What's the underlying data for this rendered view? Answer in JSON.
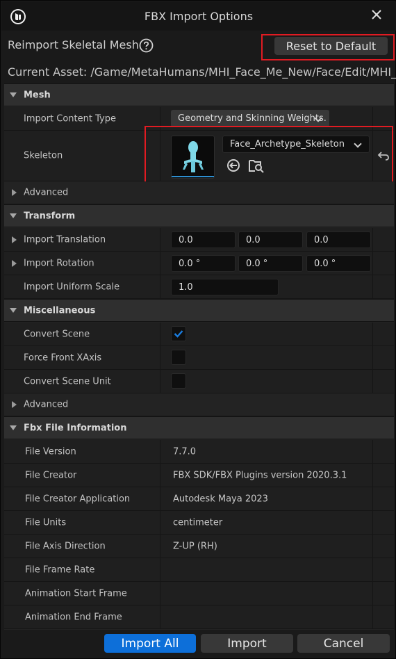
{
  "window": {
    "title": "FBX Import Options"
  },
  "header": {
    "reimport_label": "Reimport Skeletal Mesh",
    "reset_label": "Reset to Default",
    "current_asset": "Current Asset:  /Game/MetaHumans/MHI_Face_Me_New/Face/Edit/MHI_"
  },
  "mesh": {
    "category": "Mesh",
    "import_content_type": {
      "label": "Import Content Type",
      "value": "Geometry and Skinning Weights."
    },
    "skeleton": {
      "label": "Skeleton",
      "value": "Face_Archetype_Skeleton"
    },
    "advanced": "Advanced"
  },
  "transform": {
    "category": "Transform",
    "translation": {
      "label": "Import Translation",
      "x": "0.0",
      "y": "0.0",
      "z": "0.0"
    },
    "rotation": {
      "label": "Import Rotation",
      "x": "0.0 °",
      "y": "0.0 °",
      "z": "0.0 °"
    },
    "scale": {
      "label": "Import Uniform Scale",
      "value": "1.0"
    }
  },
  "misc": {
    "category": "Miscellaneous",
    "convert_scene": {
      "label": "Convert Scene",
      "checked": true
    },
    "force_front_xaxis": {
      "label": "Force Front XAxis",
      "checked": false
    },
    "convert_scene_unit": {
      "label": "Convert Scene Unit",
      "checked": false
    },
    "advanced": "Advanced"
  },
  "fbx_info": {
    "category": "Fbx File Information",
    "rows": [
      {
        "label": "File Version",
        "value": "7.7.0"
      },
      {
        "label": "File Creator",
        "value": "FBX SDK/FBX Plugins version 2020.3.1"
      },
      {
        "label": "File Creator Application",
        "value": "Autodesk Maya 2023"
      },
      {
        "label": "File Units",
        "value": "centimeter"
      },
      {
        "label": "File Axis Direction",
        "value": "Z-UP (RH)"
      },
      {
        "label": "File Frame Rate",
        "value": ""
      },
      {
        "label": "Animation Start Frame",
        "value": ""
      },
      {
        "label": "Animation End Frame",
        "value": ""
      }
    ]
  },
  "footer": {
    "import_all": "Import All",
    "import": "Import",
    "cancel": "Cancel"
  },
  "icons": {
    "logo": "unreal-logo-icon",
    "close": "close-icon",
    "help": "help-icon",
    "use_selected": "use-selected-asset-icon",
    "browse": "browse-asset-icon",
    "reset_property": "reset-property-icon"
  },
  "colors": {
    "primary_button": "#0d6fd9",
    "highlight_box": "#e11b22",
    "check_mark": "#1a7de0"
  }
}
